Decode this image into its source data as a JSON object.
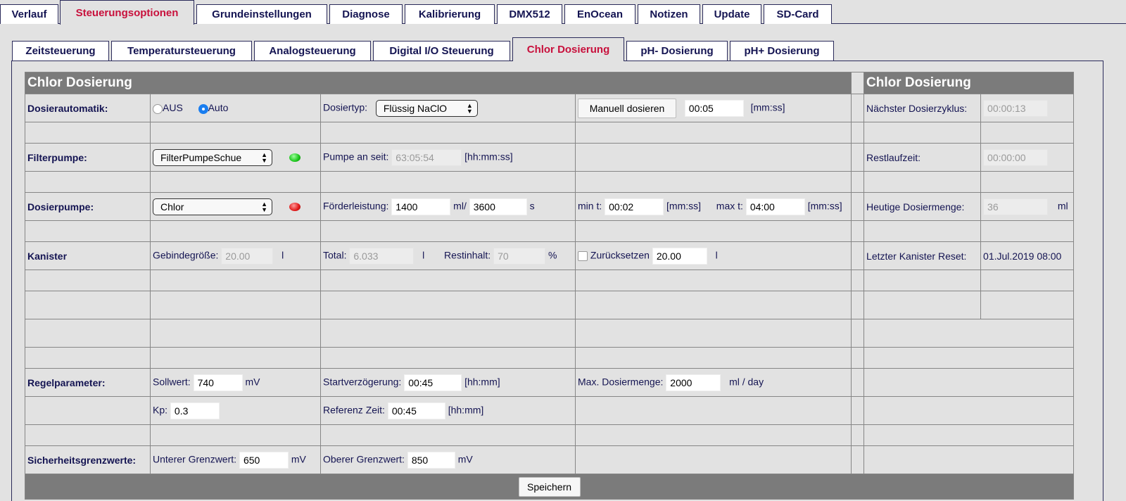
{
  "top_tabs": [
    "Verlauf",
    "Steuerungsoptionen",
    "Grundeinstellungen",
    "Diagnose",
    "Kalibrierung",
    "DMX512",
    "EnOcean",
    "Notizen",
    "Update",
    "SD-Card"
  ],
  "sub_tabs": [
    "Zeitsteuerung",
    "Temperatursteuerung",
    "Analogsteuerung",
    "Digital I/O Steuerung",
    "Chlor Dosierung",
    "pH- Dosierung",
    "pH+ Dosierung"
  ],
  "main": {
    "title": "Chlor Dosierung",
    "side_title": "Chlor Dosierung",
    "dosierautomatik": {
      "label": "Dosierautomatik:",
      "radio_off": "AUS",
      "radio_auto": "Auto",
      "selected": "Auto",
      "dosiertyp_label": "Dosiertyp:",
      "dosiertyp_value": "Flüssig NaClO",
      "manual_button": "Manuell dosieren",
      "manual_time": "00:05",
      "manual_unit": "[mm:ss]",
      "side_label": "Nächster Dosierzyklus:",
      "side_value": "00:00:13"
    },
    "filterpumpe": {
      "label": "Filterpumpe:",
      "select_value": "FilterPumpeSchue",
      "status_color": "#19c419",
      "pump_label": "Pumpe an seit:",
      "pump_value": "63:05:54",
      "pump_unit": "[hh:mm:ss]",
      "side_label": "Restlaufzeit:",
      "side_value": "00:00:00"
    },
    "dosierpumpe": {
      "label": "Dosierpumpe:",
      "select_value": "Chlor",
      "status_color": "#e01818",
      "foerder_label": "Förderleistung:",
      "foerder_ml": "1400",
      "ml_unit": "ml/",
      "foerder_s": "3600",
      "s_unit": "s",
      "min_label": "min t:",
      "min_value": "00:02",
      "min_unit": "[mm:ss]",
      "max_label": "max t:",
      "max_value": "04:00",
      "max_unit": "[mm:ss]",
      "side_label": "Heutige Dosiermenge:",
      "side_value": "36",
      "side_unit": "ml"
    },
    "kanister": {
      "label": "Kanister",
      "gebinde_label": "Gebindegröße:",
      "gebinde_value": "20.00",
      "gebinde_unit": "l",
      "total_label": "Total:",
      "total_value": "6.033",
      "total_unit": "l",
      "rest_label": "Restinhalt:",
      "rest_value": "70",
      "rest_unit": "%",
      "reset_label": "Zurücksetzen",
      "reset_value": "20.00",
      "reset_unit": "l",
      "side_label": "Letzter Kanister Reset:",
      "side_value": "01.Jul.2019 08:00"
    },
    "regel": {
      "label": "Regelparameter:",
      "soll_label": "Sollwert:",
      "soll_value": "740",
      "soll_unit": "mV",
      "start_label": "Startverzögerung:",
      "start_value": "00:45",
      "start_unit": "[hh:mm]",
      "maxd_label": "Max. Dosiermenge:",
      "maxd_value": "2000",
      "maxd_unit": "ml / day",
      "kp_label": "Kp:",
      "kp_value": "0.3",
      "ref_label": "Referenz Zeit:",
      "ref_value": "00:45",
      "ref_unit": "[hh:mm]"
    },
    "sicherheit": {
      "label": "Sicherheitsgrenzwerte:",
      "unten_label": "Unterer Grenzwert:",
      "unten_value": "650",
      "unten_unit": "mV",
      "oben_label": "Oberer Grenzwert:",
      "oben_value": "850",
      "oben_unit": "mV"
    },
    "save_button": "Speichern"
  },
  "colors": {
    "accent": "#c8103c",
    "text": "#141452",
    "header_bg": "#7b7b7b",
    "panel_bg": "#e2e2e2"
  }
}
